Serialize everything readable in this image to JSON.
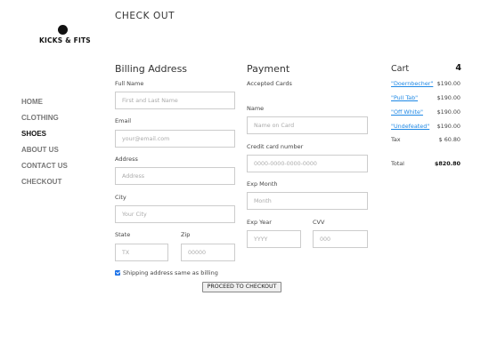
{
  "brand": {
    "logo_text": "KICKS & FITS"
  },
  "page_title": "CHECK OUT",
  "nav": [
    "HOME",
    "CLOTHING",
    "SHOES",
    "ABOUT US",
    "CONTACT US",
    "CHECKOUT"
  ],
  "nav_active": "SHOES",
  "billing": {
    "title": "Billing Address",
    "fullname_label": "Full Name",
    "fullname_placeholder": "First and Last Name",
    "email_label": "Email",
    "email_placeholder": "your@email.com",
    "address_label": "Address",
    "address_placeholder": "Address",
    "city_label": "City",
    "city_placeholder": "Your City",
    "state_label": "State",
    "state_placeholder": "TX",
    "zip_label": "Zip",
    "zip_placeholder": "00000"
  },
  "payment": {
    "title": "Payment",
    "accepted_label": "Accepted Cards",
    "name_label": "Name",
    "name_placeholder": "Name on Card",
    "cc_label": "Credit card number",
    "cc_placeholder": "0000-0000-0000-0000",
    "expmonth_label": "Exp Month",
    "expmonth_placeholder": "Month",
    "expyear_label": "Exp Year",
    "expyear_placeholder": "YYYY",
    "cvv_label": "CVV",
    "cvv_placeholder": "000"
  },
  "shipping_same": {
    "label": "Shipping address same as billing",
    "checked": true
  },
  "proceed_label": "PROCEED TO CHECKOUT",
  "cart": {
    "title": "Cart",
    "count": "4",
    "items": [
      {
        "name": "\"Doernbecher\"",
        "price": "$190.00"
      },
      {
        "name": "\"Pull Tab\"",
        "price": "$190.00"
      },
      {
        "name": "\"Off White\"",
        "price": "$190.00"
      },
      {
        "name": "\"Undefeated\"",
        "price": "$190.00"
      }
    ],
    "tax_label": "Tax",
    "tax_value": "$ 60.80",
    "total_label": "Total",
    "total_value": "$820.80"
  },
  "colors": {
    "link": "#1e88e5",
    "checkbox": "#1e73e8",
    "field_border": "#cccccc"
  }
}
